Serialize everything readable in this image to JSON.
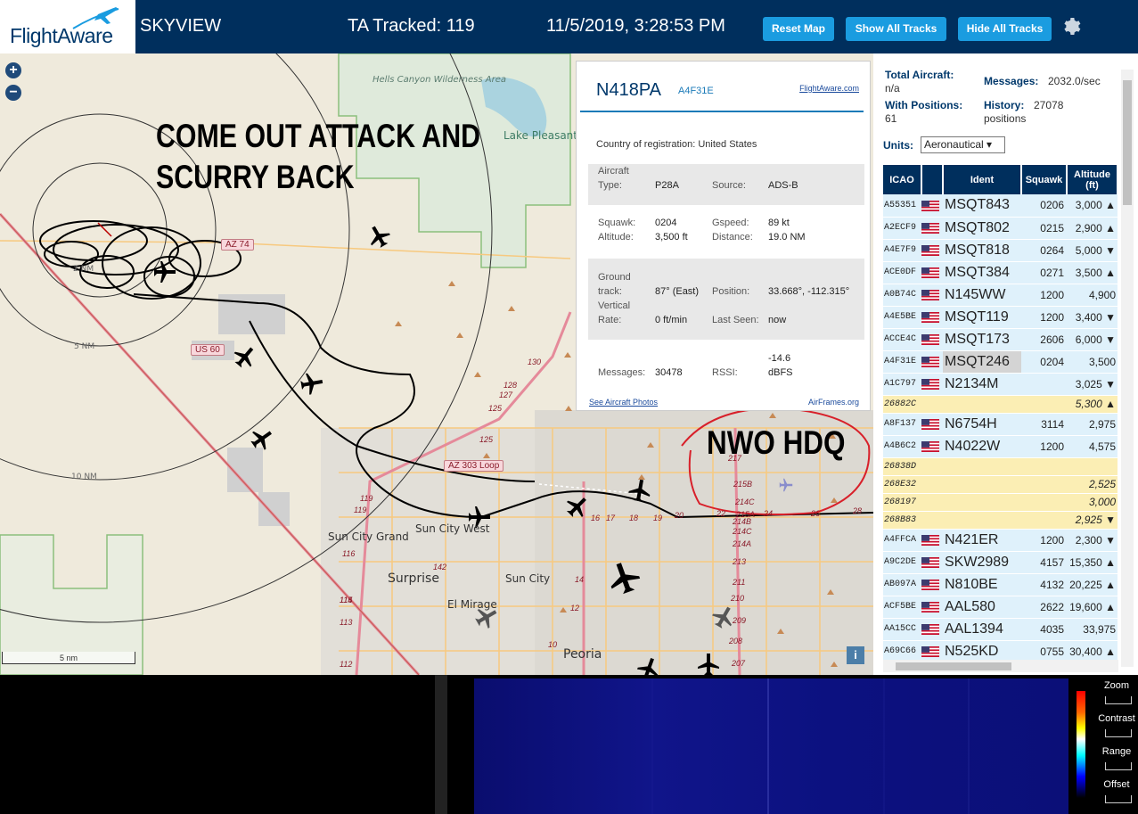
{
  "header": {
    "logo_text": "FlightAware",
    "app_title": "SKYVIEW",
    "ta_tracked": "TA Tracked: 119",
    "clock": "11/5/2019, 3:28:53 PM",
    "reset_map": "Reset Map",
    "show_all_tracks": "Show All Tracks",
    "hide_all_tracks": "Hide All Tracks",
    "settings_icon": "gear-icon"
  },
  "map": {
    "annotation_1_line1": "COME OUT ATTACK AND",
    "annotation_1_line2": "SCURRY BACK",
    "annotation_2": "NWO HDQ",
    "zoom_in": "+",
    "zoom_out": "−",
    "scale": "5 nm",
    "info": "i",
    "labels": {
      "hells_canyon": "Hells Canyon Wilderness Area",
      "lake_pleasant": "Lake Pleasant Regional Park",
      "sun_city_grand": "Sun City Grand",
      "sun_city_west": "Sun City West",
      "sun_city": "Sun City",
      "surprise": "Surprise",
      "el_mirage": "El Mirage",
      "peoria": "Peoria",
      "ring_2nm": "2 NM",
      "ring_5nm": "5 NM",
      "ring_10nm": "10 NM",
      "az74": "AZ 74",
      "us60": "US 60",
      "az303": "AZ 303 Loop"
    },
    "road_numbers": [
      "130",
      "128",
      "127",
      "125",
      "125",
      "119",
      "119",
      "116",
      "115",
      "114",
      "113",
      "112",
      "142",
      "14",
      "12",
      "10",
      "16",
      "17",
      "18",
      "19",
      "20",
      "22",
      "24",
      "26",
      "28",
      "215B",
      "215A",
      "214C",
      "214B",
      "214C",
      "214A",
      "213",
      "211",
      "210",
      "209",
      "208",
      "207",
      "217"
    ]
  },
  "popup": {
    "ident": "N418PA",
    "hex": "A4F31E",
    "fa_link": "FlightAware.com",
    "country_label": "Country of registration:",
    "country_value": "United States",
    "aircraft_type_label": "Aircraft Type:",
    "aircraft_type_label_1": "Aircraft",
    "aircraft_type_label_2": "Type:",
    "aircraft_type": "P28A",
    "source_label": "Source:",
    "source": "ADS-B",
    "squawk_label": "Squawk:",
    "squawk": "0204",
    "gspeed_label": "Gspeed:",
    "gspeed": "89 kt",
    "altitude_label": "Altitude:",
    "altitude": "3,500 ft",
    "distance_label": "Distance:",
    "distance": "19.0 NM",
    "ground_track_label_1": "Ground",
    "ground_track_label_2": "track:",
    "ground_track": "87° (East)",
    "position_label": "Position:",
    "position": "33.668°, -112.315°",
    "vrate_label_1": "Vertical",
    "vrate_label_2": "Rate:",
    "vrate": "0 ft/min",
    "last_seen_label": "Last Seen:",
    "last_seen": "now",
    "messages_label": "Messages:",
    "messages": "30478",
    "rssi_label": "RSSI:",
    "rssi_line1": "-14.6",
    "rssi_line2": "dBFS",
    "photos_link": "See Aircraft Photos",
    "airframes_link": "AirFrames.org"
  },
  "sidebar": {
    "total_aircraft_label": "Total Aircraft:",
    "total_aircraft": "n/a",
    "messages_label": "Messages:",
    "messages": "2032.0/sec",
    "with_positions_label": "With Positions:",
    "with_positions": "61",
    "history_label": "History:",
    "history_value": "27078",
    "history_unit": "positions",
    "units_label": "Units:",
    "units_value": "Aeronautical ▾",
    "columns": [
      "ICAO",
      "",
      "Ident",
      "Squawk",
      "Altitude\n(ft)"
    ],
    "rows": [
      {
        "icao": "A55351",
        "flag": true,
        "ident": "MSQT843",
        "squawk": "0206",
        "alt": "3,000 ▲"
      },
      {
        "icao": "A2ECF9",
        "flag": true,
        "ident": "MSQT802",
        "squawk": "0215",
        "alt": "2,900 ▲"
      },
      {
        "icao": "A4E7F9",
        "flag": true,
        "ident": "MSQT818",
        "squawk": "0264",
        "alt": "5,000 ▼"
      },
      {
        "icao": "ACE0DF",
        "flag": true,
        "ident": "MSQT384",
        "squawk": "0271",
        "alt": "3,500 ▲"
      },
      {
        "icao": "A0B74C",
        "flag": true,
        "ident": "N145WW",
        "squawk": "1200",
        "alt": "4,900"
      },
      {
        "icao": "A4E5BE",
        "flag": true,
        "ident": "MSQT119",
        "squawk": "1200",
        "alt": "3,400 ▼"
      },
      {
        "icao": "ACCE4C",
        "flag": true,
        "ident": "MSQT173",
        "squawk": "2606",
        "alt": "6,000 ▼"
      },
      {
        "icao": "A4F31E",
        "flag": true,
        "ident": "MSQT246",
        "squawk": "0204",
        "alt": "3,500",
        "selected": true
      },
      {
        "icao": "A1C797",
        "flag": true,
        "ident": "N2134M",
        "squawk": "",
        "alt": "3,025 ▼"
      },
      {
        "icao": "26882C",
        "flag": false,
        "ident": "",
        "squawk": "",
        "alt": "5,300 ▲",
        "noident": true
      },
      {
        "icao": "A8F137",
        "flag": true,
        "ident": "N6754H",
        "squawk": "3114",
        "alt": "2,975"
      },
      {
        "icao": "A4B6C2",
        "flag": true,
        "ident": "N4022W",
        "squawk": "1200",
        "alt": "4,575"
      },
      {
        "icao": "26838D",
        "flag": false,
        "ident": "",
        "squawk": "",
        "alt": "",
        "noident": true
      },
      {
        "icao": "268E32",
        "flag": false,
        "ident": "",
        "squawk": "",
        "alt": "2,525",
        "noident": true
      },
      {
        "icao": "268197",
        "flag": false,
        "ident": "",
        "squawk": "",
        "alt": "3,000",
        "noident": true
      },
      {
        "icao": "268B83",
        "flag": false,
        "ident": "",
        "squawk": "",
        "alt": "2,925 ▼",
        "noident": true
      },
      {
        "icao": "A4FFCA",
        "flag": true,
        "ident": "N421ER",
        "squawk": "1200",
        "alt": "2,300 ▼"
      },
      {
        "icao": "A9C2DE",
        "flag": true,
        "ident": "SKW2989",
        "squawk": "4157",
        "alt": "15,350 ▲"
      },
      {
        "icao": "AB097A",
        "flag": true,
        "ident": "N810BE",
        "squawk": "4132",
        "alt": "20,225 ▲"
      },
      {
        "icao": "ACF5BE",
        "flag": true,
        "ident": "AAL580",
        "squawk": "2622",
        "alt": "19,600 ▲"
      },
      {
        "icao": "AA15CC",
        "flag": true,
        "ident": "AAL1394",
        "squawk": "4035",
        "alt": "33,975"
      },
      {
        "icao": "A69C66",
        "flag": true,
        "ident": "N525KD",
        "squawk": "0755",
        "alt": "30,400 ▲"
      }
    ]
  },
  "bottom": {
    "zoom_label": "Zoom",
    "contrast_label": "Contrast",
    "range_label": "Range",
    "offset_label": "Offset"
  },
  "colors": {
    "header_bg": "#002f5d",
    "button": "#1a9ce0",
    "row_bg": "#dff1fb",
    "row_noident": "#fbeeb4",
    "map_bg": "#efeadc"
  }
}
